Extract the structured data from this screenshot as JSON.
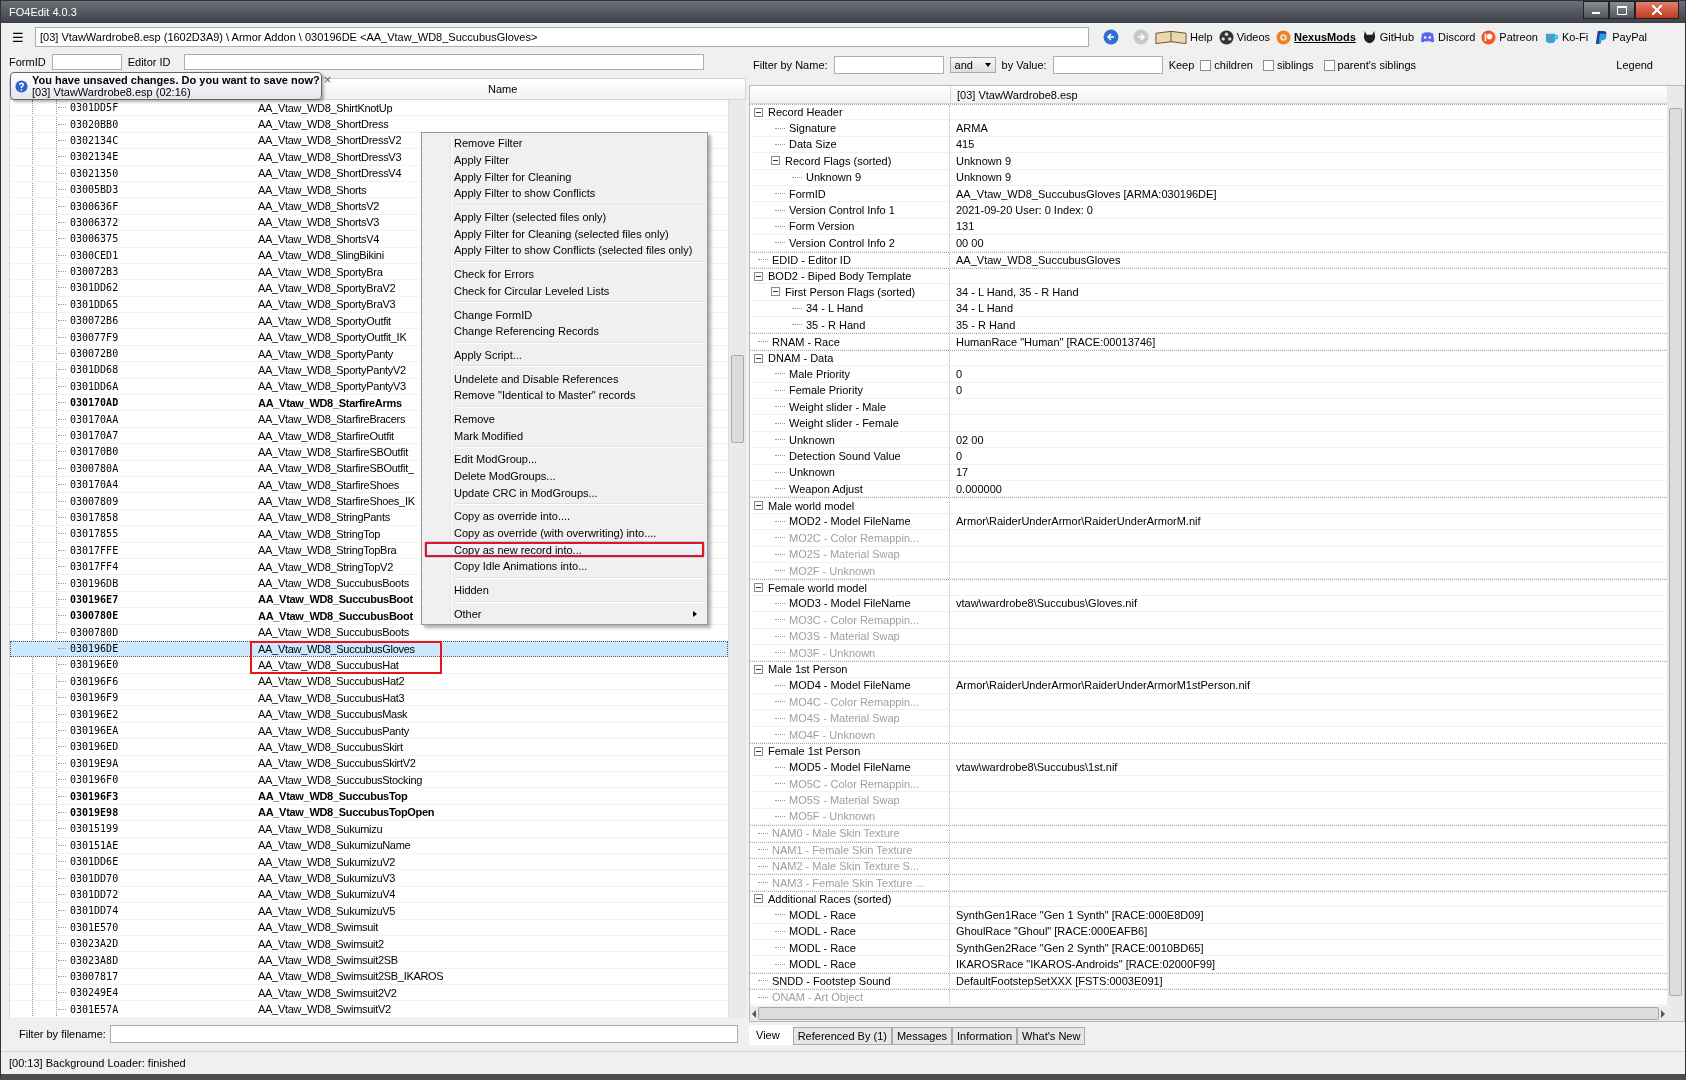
{
  "window": {
    "title": "FO4Edit 4.0.3"
  },
  "toolbar": {
    "menu_glyph": "☰",
    "path": "[03] VtawWardrobe8.esp (1602D3A9) \\ Armor Addon \\ 030196DE <AA_Vtaw_WD8_SuccubusGloves>",
    "links": [
      {
        "label": "Help",
        "kind": "book",
        "emphasized": false
      },
      {
        "label": "Videos",
        "kind": "reel",
        "emphasized": false
      },
      {
        "label": "NexusMods",
        "kind": "cog",
        "emphasized": true
      },
      {
        "label": "GitHub",
        "kind": "cat",
        "emphasized": false
      },
      {
        "label": "Discord",
        "kind": "controller",
        "emphasized": false
      },
      {
        "label": "Patreon",
        "kind": "badge",
        "emphasized": false
      },
      {
        "label": "Ko-Fi",
        "kind": "cup",
        "emphasized": false
      },
      {
        "label": "PayPal",
        "kind": "wallet",
        "emphasized": false
      }
    ]
  },
  "notification": {
    "title": "You have unsaved changes. Do you want to save now?",
    "detail": "[03] VtawWardrobe8.esp (02:16)",
    "close": "×"
  },
  "left_pane": {
    "form_id_label": "FormID",
    "editor_id_label": "Editor ID",
    "name_header": "Name",
    "rows": [
      {
        "form_id": "0301DD5F",
        "name": "AA_Vtaw_WD8_ShirtKnotUp",
        "emphasized": false,
        "selected": false
      },
      {
        "form_id": "03020BB0",
        "name": "AA_Vtaw_WD8_ShortDress",
        "emphasized": false,
        "selected": false
      },
      {
        "form_id": "0302134C",
        "name": "AA_Vtaw_WD8_ShortDressV2",
        "emphasized": false,
        "selected": false
      },
      {
        "form_id": "0302134E",
        "name": "AA_Vtaw_WD8_ShortDressV3",
        "emphasized": false,
        "selected": false
      },
      {
        "form_id": "03021350",
        "name": "AA_Vtaw_WD8_ShortDressV4",
        "emphasized": false,
        "selected": false
      },
      {
        "form_id": "03005BD3",
        "name": "AA_Vtaw_WD8_Shorts",
        "emphasized": false,
        "selected": false
      },
      {
        "form_id": "0300636F",
        "name": "AA_Vtaw_WD8_ShortsV2",
        "emphasized": false,
        "selected": false
      },
      {
        "form_id": "03006372",
        "name": "AA_Vtaw_WD8_ShortsV3",
        "emphasized": false,
        "selected": false
      },
      {
        "form_id": "03006375",
        "name": "AA_Vtaw_WD8_ShortsV4",
        "emphasized": false,
        "selected": false
      },
      {
        "form_id": "0300CED1",
        "name": "AA_Vtaw_WD8_SlingBikini",
        "emphasized": false,
        "selected": false
      },
      {
        "form_id": "030072B3",
        "name": "AA_Vtaw_WD8_SportyBra",
        "emphasized": false,
        "selected": false
      },
      {
        "form_id": "0301DD62",
        "name": "AA_Vtaw_WD8_SportyBraV2",
        "emphasized": false,
        "selected": false
      },
      {
        "form_id": "0301DD65",
        "name": "AA_Vtaw_WD8_SportyBraV3",
        "emphasized": false,
        "selected": false
      },
      {
        "form_id": "030072B6",
        "name": "AA_Vtaw_WD8_SportyOutfit",
        "emphasized": false,
        "selected": false
      },
      {
        "form_id": "030077F9",
        "name": "AA_Vtaw_WD8_SportyOutfit_IK",
        "emphasized": false,
        "selected": false
      },
      {
        "form_id": "030072B0",
        "name": "AA_Vtaw_WD8_SportyPanty",
        "emphasized": false,
        "selected": false
      },
      {
        "form_id": "0301DD68",
        "name": "AA_Vtaw_WD8_SportyPantyV2",
        "emphasized": false,
        "selected": false
      },
      {
        "form_id": "0301DD6A",
        "name": "AA_Vtaw_WD8_SportyPantyV3",
        "emphasized": false,
        "selected": false
      },
      {
        "form_id": "030170AD",
        "name": "AA_Vtaw_WD8_StarfireArms",
        "emphasized": true,
        "selected": false
      },
      {
        "form_id": "030170AA",
        "name": "AA_Vtaw_WD8_StarfireBracers",
        "emphasized": false,
        "selected": false
      },
      {
        "form_id": "030170A7",
        "name": "AA_Vtaw_WD8_StarfireOutfit",
        "emphasized": false,
        "selected": false
      },
      {
        "form_id": "030170B0",
        "name": "AA_Vtaw_WD8_StarfireSBOutfit",
        "emphasized": false,
        "selected": false
      },
      {
        "form_id": "0300780A",
        "name": "AA_Vtaw_WD8_StarfireSBOutfit_",
        "emphasized": false,
        "selected": false
      },
      {
        "form_id": "030170A4",
        "name": "AA_Vtaw_WD8_StarfireShoes",
        "emphasized": false,
        "selected": false
      },
      {
        "form_id": "03007809",
        "name": "AA_Vtaw_WD8_StarfireShoes_IK",
        "emphasized": false,
        "selected": false
      },
      {
        "form_id": "03017858",
        "name": "AA_Vtaw_WD8_StringPants",
        "emphasized": false,
        "selected": false
      },
      {
        "form_id": "03017855",
        "name": "AA_Vtaw_WD8_StringTop",
        "emphasized": false,
        "selected": false
      },
      {
        "form_id": "03017FFE",
        "name": "AA_Vtaw_WD8_StringTopBra",
        "emphasized": false,
        "selected": false
      },
      {
        "form_id": "03017FF4",
        "name": "AA_Vtaw_WD8_StringTopV2",
        "emphasized": false,
        "selected": false
      },
      {
        "form_id": "030196DB",
        "name": "AA_Vtaw_WD8_SuccubusBoots",
        "emphasized": false,
        "selected": false
      },
      {
        "form_id": "030196E7",
        "name": "AA_Vtaw_WD8_SuccubusBoot",
        "emphasized": true,
        "selected": false
      },
      {
        "form_id": "0300780E",
        "name": "AA_Vtaw_WD8_SuccubusBoot",
        "emphasized": true,
        "selected": false
      },
      {
        "form_id": "0300780D",
        "name": "AA_Vtaw_WD8_SuccubusBoots",
        "emphasized": false,
        "selected": false
      },
      {
        "form_id": "030196DE",
        "name": "AA_Vtaw_WD8_SuccubusGloves",
        "emphasized": false,
        "selected": true
      },
      {
        "form_id": "030196E0",
        "name": "AA_Vtaw_WD8_SuccubusHat",
        "emphasized": false,
        "selected": false
      },
      {
        "form_id": "030196F6",
        "name": "AA_Vtaw_WD8_SuccubusHat2",
        "emphasized": false,
        "selected": false
      },
      {
        "form_id": "030196F9",
        "name": "AA_Vtaw_WD8_SuccubusHat3",
        "emphasized": false,
        "selected": false
      },
      {
        "form_id": "030196E2",
        "name": "AA_Vtaw_WD8_SuccubusMask",
        "emphasized": false,
        "selected": false
      },
      {
        "form_id": "030196EA",
        "name": "AA_Vtaw_WD8_SuccubusPanty",
        "emphasized": false,
        "selected": false
      },
      {
        "form_id": "030196ED",
        "name": "AA_Vtaw_WD8_SuccubusSkirt",
        "emphasized": false,
        "selected": false
      },
      {
        "form_id": "03019E9A",
        "name": "AA_Vtaw_WD8_SuccubusSkirtV2",
        "emphasized": false,
        "selected": false
      },
      {
        "form_id": "030196F0",
        "name": "AA_Vtaw_WD8_SuccubusStocking",
        "emphasized": false,
        "selected": false
      },
      {
        "form_id": "030196F3",
        "name": "AA_Vtaw_WD8_SuccubusTop",
        "emphasized": true,
        "selected": false
      },
      {
        "form_id": "03019E98",
        "name": "AA_Vtaw_WD8_SuccubusTopOpen",
        "emphasized": true,
        "selected": false
      },
      {
        "form_id": "03015199",
        "name": "AA_Vtaw_WD8_Sukumizu",
        "emphasized": false,
        "selected": false
      },
      {
        "form_id": "030151AE",
        "name": "AA_Vtaw_WD8_SukumizuName",
        "emphasized": false,
        "selected": false
      },
      {
        "form_id": "0301DD6E",
        "name": "AA_Vtaw_WD8_SukumizuV2",
        "emphasized": false,
        "selected": false
      },
      {
        "form_id": "0301DD70",
        "name": "AA_Vtaw_WD8_SukumizuV3",
        "emphasized": false,
        "selected": false
      },
      {
        "form_id": "0301DD72",
        "name": "AA_Vtaw_WD8_SukumizuV4",
        "emphasized": false,
        "selected": false
      },
      {
        "form_id": "0301DD74",
        "name": "AA_Vtaw_WD8_SukumizuV5",
        "emphasized": false,
        "selected": false
      },
      {
        "form_id": "0301E570",
        "name": "AA_Vtaw_WD8_Swimsuit",
        "emphasized": false,
        "selected": false
      },
      {
        "form_id": "03023A2D",
        "name": "AA_Vtaw_WD8_Swimsuit2",
        "emphasized": false,
        "selected": false
      },
      {
        "form_id": "03023A8D",
        "name": "AA_Vtaw_WD8_Swimsuit2SB",
        "emphasized": false,
        "selected": false
      },
      {
        "form_id": "03007817",
        "name": "AA_Vtaw_WD8_Swimsuit2SB_IKAROS",
        "emphasized": false,
        "selected": false
      },
      {
        "form_id": "030249E4",
        "name": "AA_Vtaw_WD8_Swimsuit2V2",
        "emphasized": false,
        "selected": false
      },
      {
        "form_id": "0301E57A",
        "name": "AA_Vtaw_WD8_SwimsuitV2",
        "emphasized": false,
        "selected": false
      }
    ],
    "filename_filter_label": "Filter by filename:"
  },
  "context_menu": {
    "groups": [
      [
        {
          "label": "Remove Filter",
          "kind": "command",
          "hovered": false
        },
        {
          "label": "Apply Filter",
          "kind": "command",
          "hovered": false
        },
        {
          "label": "Apply Filter for Cleaning",
          "kind": "command",
          "hovered": false
        },
        {
          "label": "Apply Filter to show Conflicts",
          "kind": "command",
          "hovered": false
        }
      ],
      [
        {
          "label": "Apply Filter (selected files only)",
          "kind": "command",
          "hovered": false
        },
        {
          "label": "Apply Filter for Cleaning (selected files only)",
          "kind": "command",
          "hovered": false
        },
        {
          "label": "Apply Filter to show Conflicts (selected files only)",
          "kind": "command",
          "hovered": false
        }
      ],
      [
        {
          "label": "Check for Errors",
          "kind": "command",
          "hovered": false
        },
        {
          "label": "Check for Circular Leveled Lists",
          "kind": "command",
          "hovered": false
        }
      ],
      [
        {
          "label": "Change FormID",
          "kind": "command",
          "hovered": false
        },
        {
          "label": "Change Referencing Records",
          "kind": "command",
          "hovered": false
        }
      ],
      [
        {
          "label": "Apply Script...",
          "kind": "command",
          "hovered": false
        }
      ],
      [
        {
          "label": "Undelete and Disable References",
          "kind": "command",
          "hovered": false
        },
        {
          "label": "Remove \"Identical to Master\" records",
          "kind": "command",
          "hovered": false
        }
      ],
      [
        {
          "label": "Remove",
          "kind": "command",
          "hovered": false
        },
        {
          "label": "Mark Modified",
          "kind": "command",
          "hovered": false
        }
      ],
      [
        {
          "label": "Edit ModGroup...",
          "kind": "command",
          "hovered": false
        },
        {
          "label": "Delete ModGroups...",
          "kind": "command",
          "hovered": false
        },
        {
          "label": "Update CRC in ModGroups...",
          "kind": "command",
          "hovered": false
        }
      ],
      [
        {
          "label": "Copy as override into....",
          "kind": "command",
          "hovered": false
        },
        {
          "label": "Copy as override (with overwriting) into....",
          "kind": "command",
          "hovered": false
        },
        {
          "label": "Copy as new record into...",
          "kind": "command",
          "hovered": true
        },
        {
          "label": "Copy Idle Animations into...",
          "kind": "command",
          "hovered": false
        }
      ],
      [
        {
          "label": "Hidden",
          "kind": "command",
          "hovered": false
        }
      ],
      [
        {
          "label": "Other",
          "kind": "submenu",
          "hovered": false
        }
      ]
    ]
  },
  "right_pane": {
    "filter": {
      "name_label": "Filter by Name:",
      "operator": "and",
      "value_label": "by Value:",
      "keep_label": "Keep",
      "options": [
        {
          "label": "children",
          "checked": false
        },
        {
          "label": "siblings",
          "checked": false
        },
        {
          "label": "parent's siblings",
          "checked": false
        }
      ],
      "legend": "Legend"
    },
    "header": "[03] VtawWardrobe8.esp",
    "tree": [
      {
        "label": "Record Header",
        "expanded": true,
        "disabled": false,
        "children": [
          {
            "label": "Signature",
            "value": "ARMA",
            "disabled": false
          },
          {
            "label": "Data Size",
            "value": "415",
            "disabled": false
          },
          {
            "label": "Record Flags (sorted)",
            "value": "Unknown 9",
            "expanded": true,
            "disabled": false,
            "children": [
              {
                "label": "Unknown 9",
                "value": "Unknown 9",
                "disabled": false
              }
            ]
          },
          {
            "label": "FormID",
            "value": "AA_Vtaw_WD8_SuccubusGloves [ARMA:030196DE]",
            "disabled": false
          },
          {
            "label": "Version Control Info 1",
            "value": "2021-09-20 User: 0 Index: 0",
            "disabled": false
          },
          {
            "label": "Form Version",
            "value": "131",
            "disabled": false
          },
          {
            "label": "Version Control Info 2",
            "value": "00 00",
            "disabled": false
          }
        ]
      },
      {
        "label": "EDID - Editor ID",
        "value": "AA_Vtaw_WD8_SuccubusGloves",
        "disabled": false
      },
      {
        "label": "BOD2 - Biped Body Template",
        "expanded": true,
        "disabled": false,
        "children": [
          {
            "label": "First Person Flags (sorted)",
            "value": "34 - L Hand, 35 - R Hand",
            "expanded": true,
            "disabled": false,
            "children": [
              {
                "label": "34 - L Hand",
                "value": "34 - L Hand",
                "disabled": false
              },
              {
                "label": "35 - R Hand",
                "value": "35 - R Hand",
                "disabled": false
              }
            ]
          }
        ]
      },
      {
        "label": "RNAM - Race",
        "value": "HumanRace \"Human\" [RACE:00013746]",
        "disabled": false
      },
      {
        "label": "DNAM - Data",
        "expanded": true,
        "disabled": false,
        "children": [
          {
            "label": "Male Priority",
            "value": "0",
            "disabled": false
          },
          {
            "label": "Female Priority",
            "value": "0",
            "disabled": false
          },
          {
            "label": "Weight slider - Male",
            "disabled": false
          },
          {
            "label": "Weight slider - Female",
            "disabled": false
          },
          {
            "label": "Unknown",
            "value": "02 00",
            "disabled": false
          },
          {
            "label": "Detection Sound Value",
            "value": "0",
            "disabled": false
          },
          {
            "label": "Unknown",
            "value": "17",
            "disabled": false
          },
          {
            "label": "Weapon Adjust",
            "value": "0.000000",
            "disabled": false
          }
        ]
      },
      {
        "label": "Male world model",
        "expanded": true,
        "disabled": false,
        "children": [
          {
            "label": "MOD2 - Model FileName",
            "value": "Armor\\RaiderUnderArmor\\RaiderUnderArmorM.nif",
            "disabled": false
          },
          {
            "label": "MO2C - Color Remappin...",
            "disabled": true
          },
          {
            "label": "MO2S - Material Swap",
            "disabled": true
          },
          {
            "label": "MO2F - Unknown",
            "disabled": true
          }
        ]
      },
      {
        "label": "Female world model",
        "expanded": true,
        "disabled": false,
        "children": [
          {
            "label": "MOD3 - Model FileName",
            "value": "vtaw\\wardrobe8\\Succubus\\Gloves.nif",
            "disabled": false
          },
          {
            "label": "MO3C - Color Remappin...",
            "disabled": true
          },
          {
            "label": "MO3S - Material Swap",
            "disabled": true
          },
          {
            "label": "MO3F - Unknown",
            "disabled": true
          }
        ]
      },
      {
        "label": "Male 1st Person",
        "expanded": true,
        "disabled": false,
        "children": [
          {
            "label": "MOD4 - Model FileName",
            "value": "Armor\\RaiderUnderArmor\\RaiderUnderArmorM1stPerson.nif",
            "disabled": false
          },
          {
            "label": "MO4C - Color Remappin...",
            "disabled": true
          },
          {
            "label": "MO4S - Material Swap",
            "disabled": true
          },
          {
            "label": "MO4F - Unknown",
            "disabled": true
          }
        ]
      },
      {
        "label": "Female 1st Person",
        "expanded": true,
        "disabled": false,
        "children": [
          {
            "label": "MOD5 - Model FileName",
            "value": "vtaw\\wardrobe8\\Succubus\\1st.nif",
            "disabled": false
          },
          {
            "label": "MO5C - Color Remappin...",
            "disabled": true
          },
          {
            "label": "MO5S - Material Swap",
            "disabled": true
          },
          {
            "label": "MO5F - Unknown",
            "disabled": true
          }
        ]
      },
      {
        "label": "NAM0 - Male Skin Texture",
        "disabled": true
      },
      {
        "label": "NAM1 - Female Skin Texture",
        "disabled": true
      },
      {
        "label": "NAM2 - Male Skin Texture S...",
        "disabled": true
      },
      {
        "label": "NAM3 - Female Skin Texture ...",
        "disabled": true
      },
      {
        "label": "Additional Races (sorted)",
        "expanded": true,
        "disabled": false,
        "children": [
          {
            "label": "MODL - Race",
            "value": "SynthGen1Race \"Gen 1 Synth\" [RACE:000E8D09]",
            "disabled": false
          },
          {
            "label": "MODL - Race",
            "value": "GhoulRace \"Ghoul\" [RACE:000EAFB6]",
            "disabled": false
          },
          {
            "label": "MODL - Race",
            "value": "SynthGen2Race \"Gen 2 Synth\" [RACE:0010BD65]",
            "disabled": false
          },
          {
            "label": "MODL - Race",
            "value": "IKAROSRace \"IKAROS-Androids\" [RACE:02000F99]",
            "disabled": false
          }
        ]
      },
      {
        "label": "SNDD - Footstep Sound",
        "value": "DefaultFootstepSetXXX [FSTS:0003E091]",
        "disabled": false
      },
      {
        "label": "ONAM - Art Object",
        "disabled": true
      }
    ],
    "tabs": [
      {
        "label": "View",
        "selected": true
      },
      {
        "label": "Referenced By (1)",
        "selected": false
      },
      {
        "label": "Messages",
        "selected": false
      },
      {
        "label": "Information",
        "selected": false
      },
      {
        "label": "What's New",
        "selected": false
      }
    ]
  },
  "status_bar": "[00:13] Background Loader: finished"
}
